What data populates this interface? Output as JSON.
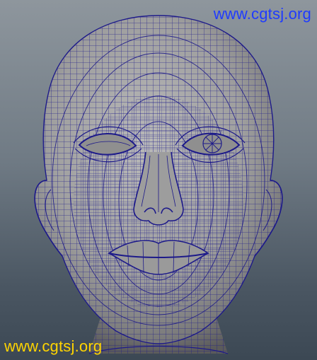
{
  "viewport": {
    "background_top": "#8e969d",
    "background_bottom": "#3c4854"
  },
  "model": {
    "subject": "head-wireframe",
    "surface_color": "#a9a9a9",
    "wire_color": "#1d1a8a"
  },
  "watermarks": {
    "top": {
      "text": "www.cgtsj.org",
      "color": "#1f3bff"
    },
    "bottom": {
      "text": "www.cgtsj.org",
      "color": "#ffd400"
    }
  }
}
